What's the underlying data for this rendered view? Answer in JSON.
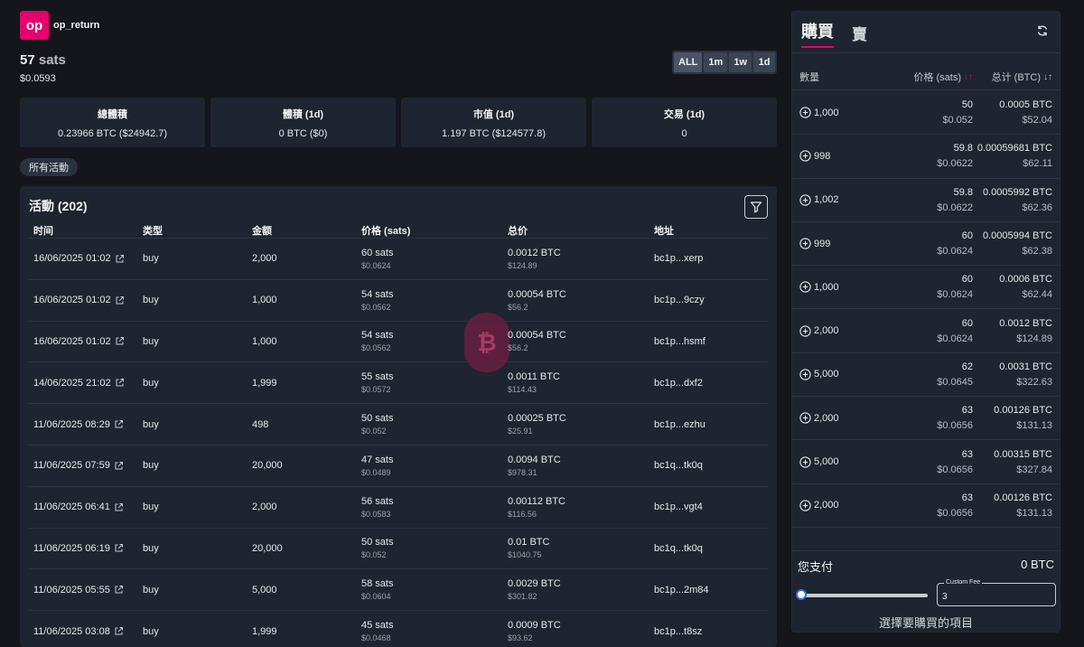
{
  "token": {
    "logo_text": "op",
    "name": "op_return",
    "price_value": "57",
    "price_unit": "sats",
    "price_usd": "$0.0593"
  },
  "time_ranges": [
    {
      "label": "ALL",
      "active": true
    },
    {
      "label": "1m",
      "active": false
    },
    {
      "label": "1w",
      "active": false
    },
    {
      "label": "1d",
      "active": false
    }
  ],
  "stats": [
    {
      "label": "總體積",
      "value": "0.23966 BTC ($24942.7)"
    },
    {
      "label": "體積 (1d)",
      "value": "0 BTC ($0)"
    },
    {
      "label": "市值 (1d)",
      "value": "1.197 BTC ($124577.8)"
    },
    {
      "label": "交易 (1d)",
      "value": "0"
    }
  ],
  "filter_pill": "所有活動",
  "activity": {
    "title": "活動 (202)",
    "headers": [
      "时间",
      "类型",
      "金额",
      "价格 (sats)",
      "总价",
      "地址"
    ],
    "rows": [
      {
        "time": "16/06/2025 01:02",
        "type": "buy",
        "amount": "2,000",
        "price": "60 sats",
        "price_usd": "$0.0624",
        "total": "0.0012 BTC",
        "total_usd": "$124.89",
        "address": "bc1p...xerp"
      },
      {
        "time": "16/06/2025 01:02",
        "type": "buy",
        "amount": "1,000",
        "price": "54 sats",
        "price_usd": "$0.0562",
        "total": "0.00054 BTC",
        "total_usd": "$56.2",
        "address": "bc1p...9czy"
      },
      {
        "time": "16/06/2025 01:02",
        "type": "buy",
        "amount": "1,000",
        "price": "54 sats",
        "price_usd": "$0.0562",
        "total": "0.00054 BTC",
        "total_usd": "$56.2",
        "address": "bc1p...hsmf"
      },
      {
        "time": "14/06/2025 21:02",
        "type": "buy",
        "amount": "1,999",
        "price": "55 sats",
        "price_usd": "$0.0572",
        "total": "0.0011 BTC",
        "total_usd": "$114.43",
        "address": "bc1p...dxf2"
      },
      {
        "time": "11/06/2025 08:29",
        "type": "buy",
        "amount": "498",
        "price": "50 sats",
        "price_usd": "$0.052",
        "total": "0.00025 BTC",
        "total_usd": "$25.91",
        "address": "bc1p...ezhu"
      },
      {
        "time": "11/06/2025 07:59",
        "type": "buy",
        "amount": "20,000",
        "price": "47 sats",
        "price_usd": "$0.0489",
        "total": "0.0094 BTC",
        "total_usd": "$978.31",
        "address": "bc1q...tk0q"
      },
      {
        "time": "11/06/2025 06:41",
        "type": "buy",
        "amount": "2,000",
        "price": "56 sats",
        "price_usd": "$0.0583",
        "total": "0.00112 BTC",
        "total_usd": "$116.56",
        "address": "bc1p...vgt4"
      },
      {
        "time": "11/06/2025 06:19",
        "type": "buy",
        "amount": "20,000",
        "price": "50 sats",
        "price_usd": "$0.052",
        "total": "0.01 BTC",
        "total_usd": "$1040.75",
        "address": "bc1q...tk0q"
      },
      {
        "time": "11/06/2025 05:55",
        "type": "buy",
        "amount": "5,000",
        "price": "58 sats",
        "price_usd": "$0.0604",
        "total": "0.0029 BTC",
        "total_usd": "$301.82",
        "address": "bc1p...2m84"
      },
      {
        "time": "11/06/2025 03:08",
        "type": "buy",
        "amount": "1,999",
        "price": "45 sats",
        "price_usd": "$0.0468",
        "total": "0.0009 BTC",
        "total_usd": "$93.62",
        "address": "bc1p...t8sz"
      }
    ]
  },
  "watermark_symbol": "₿",
  "trade_panel": {
    "tab_buy": "購買",
    "tab_sell": "賣",
    "headers": {
      "qty": "數量",
      "price": "价格 (sats)",
      "total": "总计 (BTC)"
    },
    "orders": [
      {
        "qty": "1,000",
        "price": "50",
        "price_usd": "$0.052",
        "total": "0.0005 BTC",
        "total_usd": "$52.04"
      },
      {
        "qty": "998",
        "price": "59.8",
        "price_usd": "$0.0622",
        "total": "0.00059681 BTC",
        "total_usd": "$62.11"
      },
      {
        "qty": "1,002",
        "price": "59.8",
        "price_usd": "$0.0622",
        "total": "0.0005992 BTC",
        "total_usd": "$62.36"
      },
      {
        "qty": "999",
        "price": "60",
        "price_usd": "$0.0624",
        "total": "0.0005994 BTC",
        "total_usd": "$62.38"
      },
      {
        "qty": "1,000",
        "price": "60",
        "price_usd": "$0.0624",
        "total": "0.0006 BTC",
        "total_usd": "$62.44"
      },
      {
        "qty": "2,000",
        "price": "60",
        "price_usd": "$0.0624",
        "total": "0.0012 BTC",
        "total_usd": "$124.89"
      },
      {
        "qty": "5,000",
        "price": "62",
        "price_usd": "$0.0645",
        "total": "0.0031 BTC",
        "total_usd": "$322.63"
      },
      {
        "qty": "2,000",
        "price": "63",
        "price_usd": "$0.0656",
        "total": "0.00126 BTC",
        "total_usd": "$131.13"
      },
      {
        "qty": "5,000",
        "price": "63",
        "price_usd": "$0.0656",
        "total": "0.00315 BTC",
        "total_usd": "$327.84"
      },
      {
        "qty": "2,000",
        "price": "63",
        "price_usd": "$0.0656",
        "total": "0.00126 BTC",
        "total_usd": "$131.13"
      }
    ],
    "pay_label": "您支付",
    "pay_value": "0 BTC",
    "fee_label": "Custom Fee",
    "fee_value": "3",
    "select_hint": "選擇要購買的項目"
  },
  "colors": {
    "accent": "#e5006e",
    "background": "#14161b",
    "panel": "#1e2530"
  }
}
